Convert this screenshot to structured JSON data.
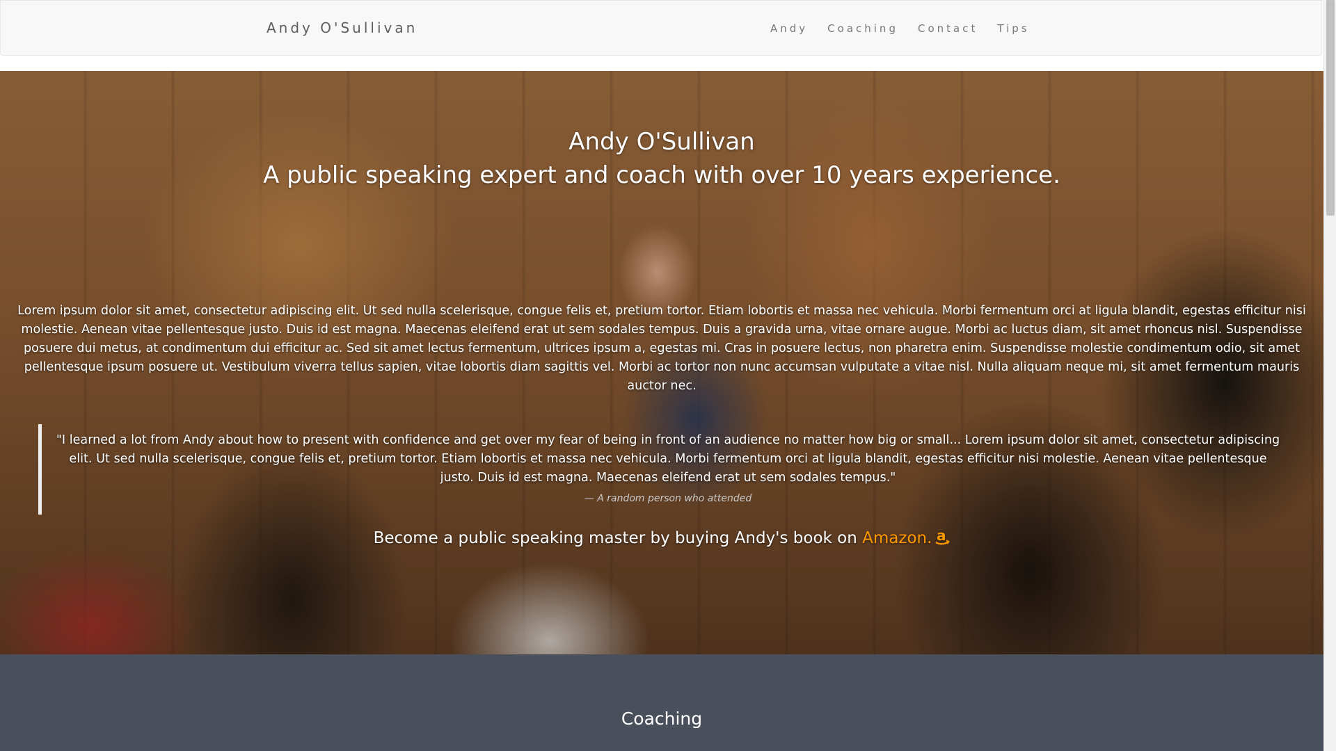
{
  "navbar": {
    "brand": "Andy O'Sullivan",
    "links": [
      {
        "label": "Andy"
      },
      {
        "label": "Coaching"
      },
      {
        "label": "Contact"
      },
      {
        "label": "Tips"
      }
    ]
  },
  "hero": {
    "title": "Andy O'Sullivan",
    "subtitle": "A public speaking expert and coach with over 10 years experience.",
    "paragraph": "Lorem ipsum dolor sit amet, consectetur adipiscing elit. Ut sed nulla scelerisque, congue felis et, pretium tortor. Etiam lobortis et massa nec vehicula. Morbi fermentum orci at ligula blandit, egestas efficitur nisi molestie. Aenean vitae pellentesque justo. Duis id est magna. Maecenas eleifend erat ut sem sodales tempus. Duis a gravida urna, vitae ornare augue. Morbi ac luctus diam, sit amet rhoncus nisl. Suspendisse posuere dui metus, at condimentum dui efficitur ac. Sed sit amet lectus fermentum, ultrices ipsum a, egestas mi. Cras in posuere lectus, non pharetra enim. Suspendisse molestie condimentum odio, sit amet pellentesque ipsum posuere ut. Vestibulum viverra tellus sapien, vitae lobortis diam sagittis vel. Morbi ac tortor non nunc accumsan vulputate a vitae nisl. Nulla aliquam neque mi, sit amet fermentum mauris auctor nec.",
    "quote": "\"I learned a lot from Andy about how to present with confidence and get over my fear of being in front of an audience no matter how big or small... Lorem ipsum dolor sit amet, consectetur adipiscing elit. Ut sed nulla scelerisque, congue felis et, pretium tortor. Etiam lobortis et massa nec vehicula. Morbi fermentum orci at ligula blandit, egestas efficitur nisi molestie. Aenean vitae pellentesque justo. Duis id est magna. Maecenas eleifend erat ut sem sodales tempus.\"",
    "quote_cite": "— A random person who attended",
    "cta_text": "Become a public speaking master by buying Andy's book on ",
    "cta_link": "Amazon.",
    "cta_icon": "amazon-icon"
  },
  "coaching": {
    "title": "Coaching"
  },
  "colors": {
    "nav_bg": "#f8f8f8",
    "nav_text": "#777777",
    "amazon_link": "#ff9900",
    "coaching_bg": "#4a4f5c"
  }
}
